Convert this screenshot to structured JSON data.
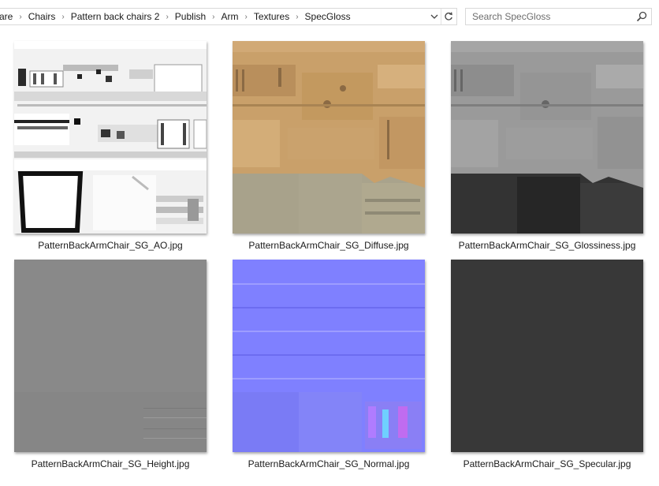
{
  "address_bar": {
    "breadcrumbs": [
      "are",
      "Chairs",
      "Pattern back chairs 2",
      "Publish",
      "Arm",
      "Textures",
      "SpecGloss"
    ],
    "separator_icon": "chevron-right-icon",
    "dropdown_icon": "chevron-down-icon",
    "refresh_icon": "refresh-icon"
  },
  "search": {
    "placeholder": "Search SpecGloss",
    "value": "",
    "icon": "search-icon"
  },
  "files": [
    {
      "name": "PatternBackArmChair_SG_AO.jpg",
      "thumbnail": "ao-map"
    },
    {
      "name": "PatternBackArmChair_SG_Diffuse.jpg",
      "thumbnail": "diffuse-map"
    },
    {
      "name": "PatternBackArmChair_SG_Glossiness.jpg",
      "thumbnail": "glossiness-map"
    },
    {
      "name": "PatternBackArmChair_SG_Height.jpg",
      "thumbnail": "height-map"
    },
    {
      "name": "PatternBackArmChair_SG_Normal.jpg",
      "thumbnail": "normal-map"
    },
    {
      "name": "PatternBackArmChair_SG_Specular.jpg",
      "thumbnail": "specular-map"
    }
  ],
  "colors": {
    "ao_base": "#f2f2f2",
    "diffuse_wood": "#c9a06a",
    "diffuse_fabric": "#a9a38c",
    "gloss_base": "#9a9a9a",
    "gloss_fabric": "#333333",
    "height_base": "#868686",
    "normal_base": "#7f80ff",
    "specular_base": "#383838"
  }
}
